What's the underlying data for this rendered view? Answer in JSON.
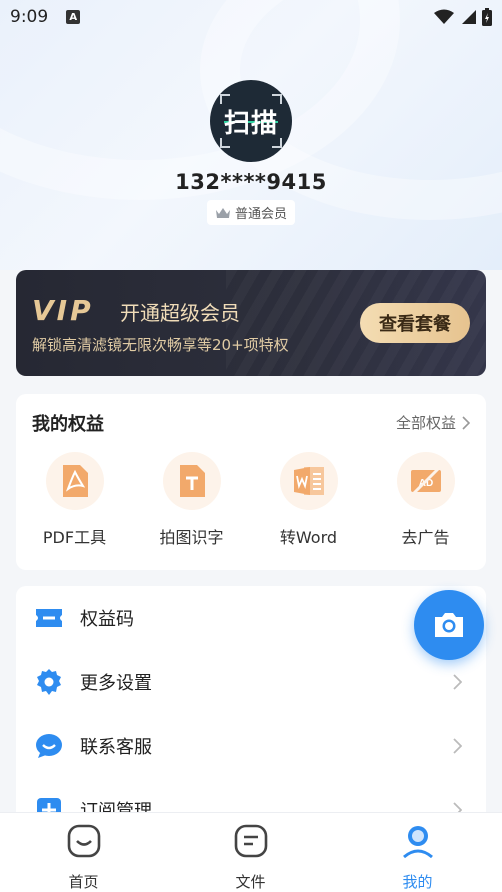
{
  "status_bar": {
    "time": "9:09",
    "notification_icon": "A"
  },
  "profile": {
    "avatar_text": "扫描",
    "phone": "132****9415",
    "member_level": "普通会员"
  },
  "vip": {
    "logo": "VIP",
    "title": "开通超级会员",
    "subtitle": "解锁高清滤镜无限次畅享等20+项特权",
    "button": "查看套餐"
  },
  "benefits": {
    "title": "我的权益",
    "all_label": "全部权益",
    "items": [
      {
        "label": "PDF工具",
        "icon": "pdf-icon"
      },
      {
        "label": "拍图识字",
        "icon": "text-recognition-icon"
      },
      {
        "label": "转Word",
        "icon": "word-icon"
      },
      {
        "label": "去广告",
        "icon": "remove-ads-icon"
      }
    ]
  },
  "menu": {
    "items": [
      {
        "label": "权益码",
        "icon": "ticket-icon"
      },
      {
        "label": "更多设置",
        "icon": "gear-icon"
      },
      {
        "label": "联系客服",
        "icon": "chat-icon"
      },
      {
        "label": "订阅管理",
        "icon": "plus-icon"
      }
    ]
  },
  "tabs": [
    {
      "label": "首页",
      "icon": "home-icon",
      "active": false
    },
    {
      "label": "文件",
      "icon": "file-icon",
      "active": false
    },
    {
      "label": "我的",
      "icon": "profile-icon",
      "active": true
    }
  ],
  "colors": {
    "accent": "#2e8cf0",
    "vip_gold": "#e6c896",
    "benefit_icon": "#f2a96b",
    "menu_icon": "#2e8cf0"
  }
}
